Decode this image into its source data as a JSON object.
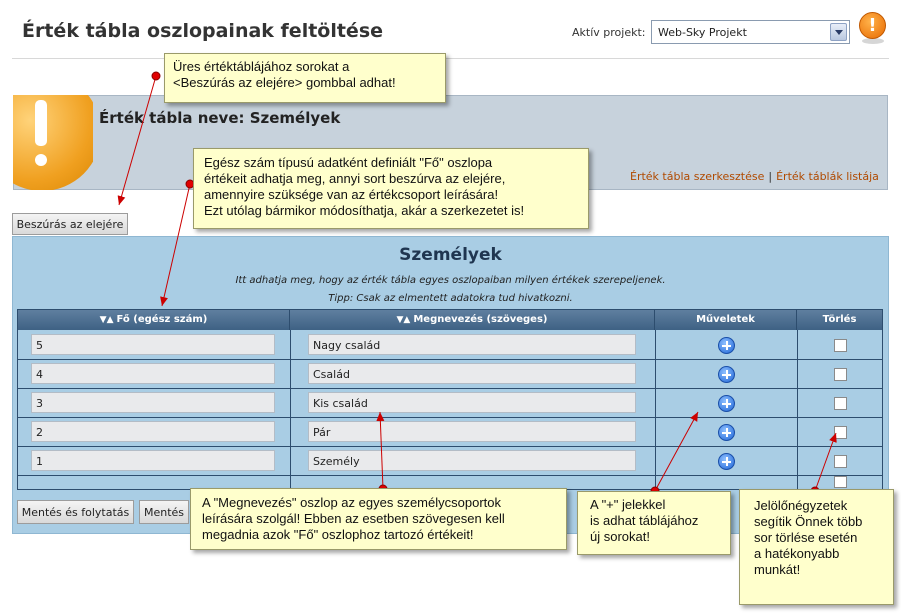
{
  "header": {
    "title": "Érték tábla oszlopainak feltöltése",
    "project_label": "Aktív projekt:",
    "project_value": "Web-Sky Projekt"
  },
  "info": {
    "table_name": "Érték tábla neve: Személyek",
    "link_edit": "Érték tábla szerkesztése",
    "link_list": "Érték táblák listája"
  },
  "buttons": {
    "insert_top": "Beszúrás az elejére",
    "save_continue": "Mentés és folytatás",
    "save": "Mentés"
  },
  "panel": {
    "title": "Személyek",
    "subtitle": "Itt adhatja meg, hogy az érték tábla egyes oszlopaiban milyen értékek szerepeljenek.",
    "tip": "Tipp: Csak az elmentett adatokra tud hivatkozni."
  },
  "table": {
    "columns": [
      "Fő (egész szám)",
      "Megnevezés (szöveges)",
      "Műveletek",
      "Törlés"
    ],
    "rows": [
      {
        "fo": "5",
        "megnevezes": "Nagy család"
      },
      {
        "fo": "4",
        "megnevezes": "Család"
      },
      {
        "fo": "3",
        "megnevezes": "Kis család"
      },
      {
        "fo": "2",
        "megnevezes": "Pár"
      },
      {
        "fo": "1",
        "megnevezes": "Személy"
      }
    ]
  },
  "notes": {
    "n1": [
      "Üres értéktáblájához sorokat a",
      "<Beszúrás az elejére> gombbal adhat!"
    ],
    "n2": [
      "Egész szám típusú adatként definiált \"Fő\" oszlopa",
      "értékeit adhatja meg, annyi sort beszúrva az elejére,",
      "amennyire szüksége van az értékcsoport leírására!",
      "Ezt utólag bármikor módosíthatja, akár a szerkezetet is!"
    ],
    "n3": [
      "A \"Megnevezés\" oszlop az egyes személycsoportok",
      "leírására szolgál! Ebben az esetben szövegesen kell",
      "megadnia azok \"Fő\" oszlophoz tartozó értékeit!"
    ],
    "n4": [
      "A \"+\" jelekkel",
      "is adhat táblájához",
      "új sorokat!"
    ],
    "n5": [
      "Jelölőnégyzetek",
      "segítik Önnek több",
      "sor törlése esetén",
      "a hatékonyabb",
      "munkát!"
    ]
  },
  "colors": {
    "panel_bg": "#a9cde4",
    "header_bg": "#3e6184",
    "note_bg": "#ffffcc",
    "link": "#b04a00",
    "warning": "#f0a020",
    "arrow": "#cc0000"
  },
  "icons": [
    "warning-icon",
    "plus-icon",
    "dropdown-arrow-icon",
    "sort-arrows-icon"
  ]
}
